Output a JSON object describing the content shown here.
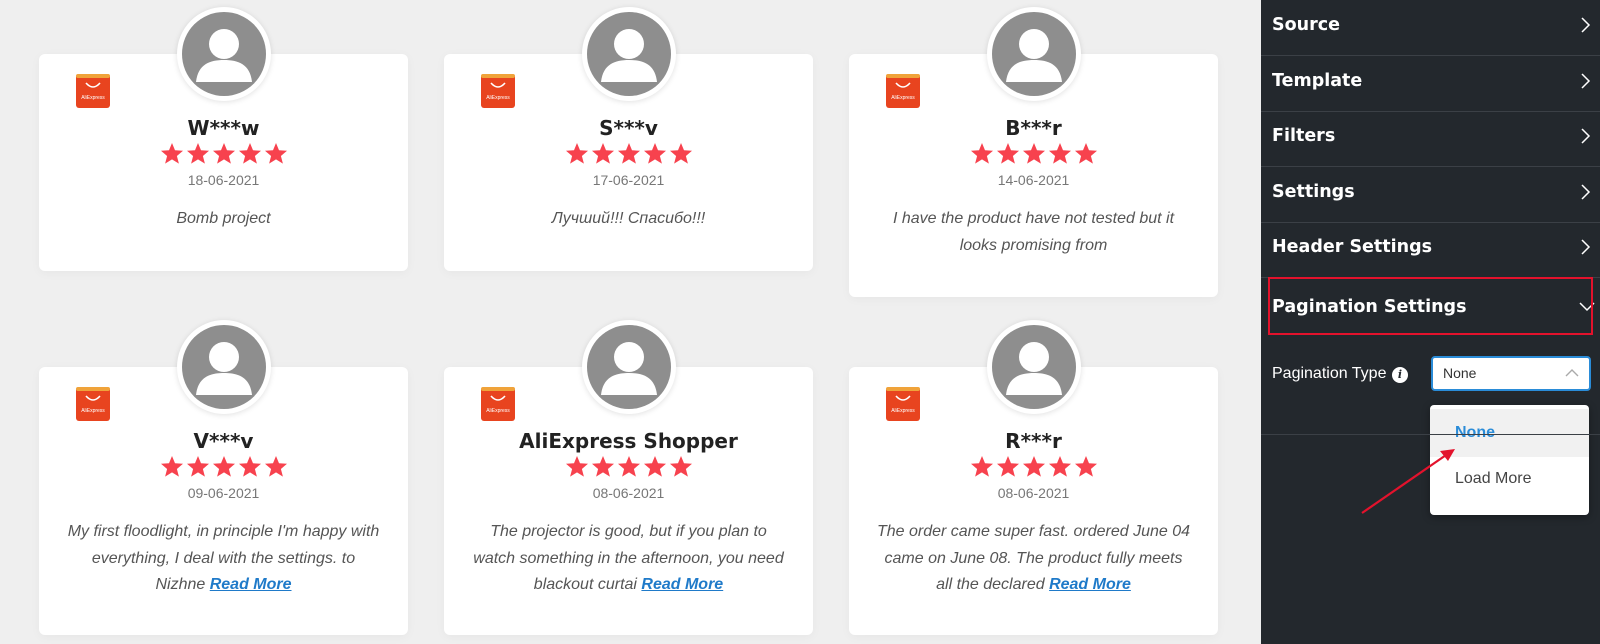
{
  "reviews": [
    {
      "name": "W***w",
      "rating": 5,
      "date": "18-06-2021",
      "text": "Bomb project",
      "read_more": "",
      "platform_icon": "aliexpress-logo-icon",
      "avatar_icon": "user-avatar-icon"
    },
    {
      "name": "S***v",
      "rating": 5,
      "date": "17-06-2021",
      "text": "Лучший!!! Спасибо!!!",
      "read_more": "",
      "platform_icon": "aliexpress-logo-icon",
      "avatar_icon": "user-avatar-icon"
    },
    {
      "name": "B***r",
      "rating": 5,
      "date": "14-06-2021",
      "text": "I have the product have not tested but it looks promising from",
      "read_more": "",
      "platform_icon": "aliexpress-logo-icon",
      "avatar_icon": "user-avatar-icon"
    },
    {
      "name": "V***v",
      "rating": 5,
      "date": "09-06-2021",
      "text": "My first floodlight, in principle I'm happy with everything, I deal with the settings. to Nizhne ",
      "read_more": "Read More",
      "platform_icon": "aliexpress-logo-icon",
      "avatar_icon": "user-avatar-icon"
    },
    {
      "name": "AliExpress Shopper",
      "rating": 5,
      "date": "08-06-2021",
      "text": "The projector is good, but if you plan to watch something in the afternoon, you need blackout curtai ",
      "read_more": "Read More",
      "platform_icon": "aliexpress-logo-icon",
      "avatar_icon": "user-avatar-icon"
    },
    {
      "name": "R***r",
      "rating": 5,
      "date": "08-06-2021",
      "text": "The order came super fast. ordered June 04 came on June 08. The product fully meets all the declared ",
      "read_more": "Read More",
      "platform_icon": "aliexpress-logo-icon",
      "avatar_icon": "user-avatar-icon"
    }
  ],
  "platform_logo_text": "AliExpress",
  "panel": {
    "sections": [
      {
        "label": "Source",
        "icon": "chevron-right-icon"
      },
      {
        "label": "Template",
        "icon": "chevron-right-icon"
      },
      {
        "label": "Filters",
        "icon": "chevron-right-icon"
      },
      {
        "label": "Settings",
        "icon": "chevron-right-icon"
      },
      {
        "label": "Header Settings",
        "icon": "chevron-right-icon"
      },
      {
        "label": "Pagination Settings",
        "icon": "chevron-down-icon"
      }
    ],
    "pagination_type_label": "Pagination Type",
    "info_icon_glyph": "i",
    "selected_value": "None",
    "options": [
      "None",
      "Load More"
    ]
  },
  "colors": {
    "star": "#f7424e",
    "panel_bg": "#23282d",
    "highlight": "#e3122c",
    "accent": "#2a8cd8",
    "link": "#1f7ac9",
    "aliexpress": "#e8441f"
  }
}
